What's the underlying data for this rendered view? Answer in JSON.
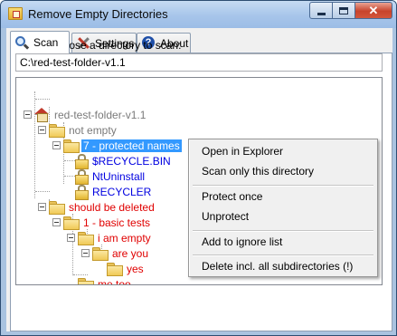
{
  "window": {
    "title": "Remove Empty Directories"
  },
  "tabs": [
    {
      "label": "Scan",
      "icon": "search-icon",
      "active": true
    },
    {
      "label": "Settings",
      "icon": "tools-icon",
      "active": false
    },
    {
      "label": "About",
      "icon": "help-icon",
      "active": false
    }
  ],
  "scan": {
    "prompt": "Please choose a directory to scan:",
    "path_value": "C:\\red-test-folder-v1.1"
  },
  "tree": {
    "root": "red-test-folder-v1.1",
    "not_empty": "not empty",
    "protected_names": "7 - protected names",
    "recycle_bin": "$RECYCLE.BIN",
    "nt_uninstall": "NtUninstall",
    "recycler": "RECYCLER",
    "should_be_deleted": "should be deleted",
    "basic_tests": "1 - basic tests",
    "i_am_empty": "i am empty",
    "are_you": "are you",
    "yes": "yes",
    "me_too": "me too"
  },
  "context_menu": {
    "open_in_explorer": "Open in Explorer",
    "scan_only_this": "Scan only this directory",
    "protect_once": "Protect once",
    "unprotect": "Unprotect",
    "add_to_ignore": "Add to ignore list",
    "delete_all": "Delete incl. all subdirectories (!)"
  },
  "colors": {
    "titlebar": "#a7c5ea",
    "selection": "#3399ff",
    "empty_red": "#e00000",
    "protected_blue": "#0000e0",
    "not_empty_gray": "#7a7a7a"
  }
}
